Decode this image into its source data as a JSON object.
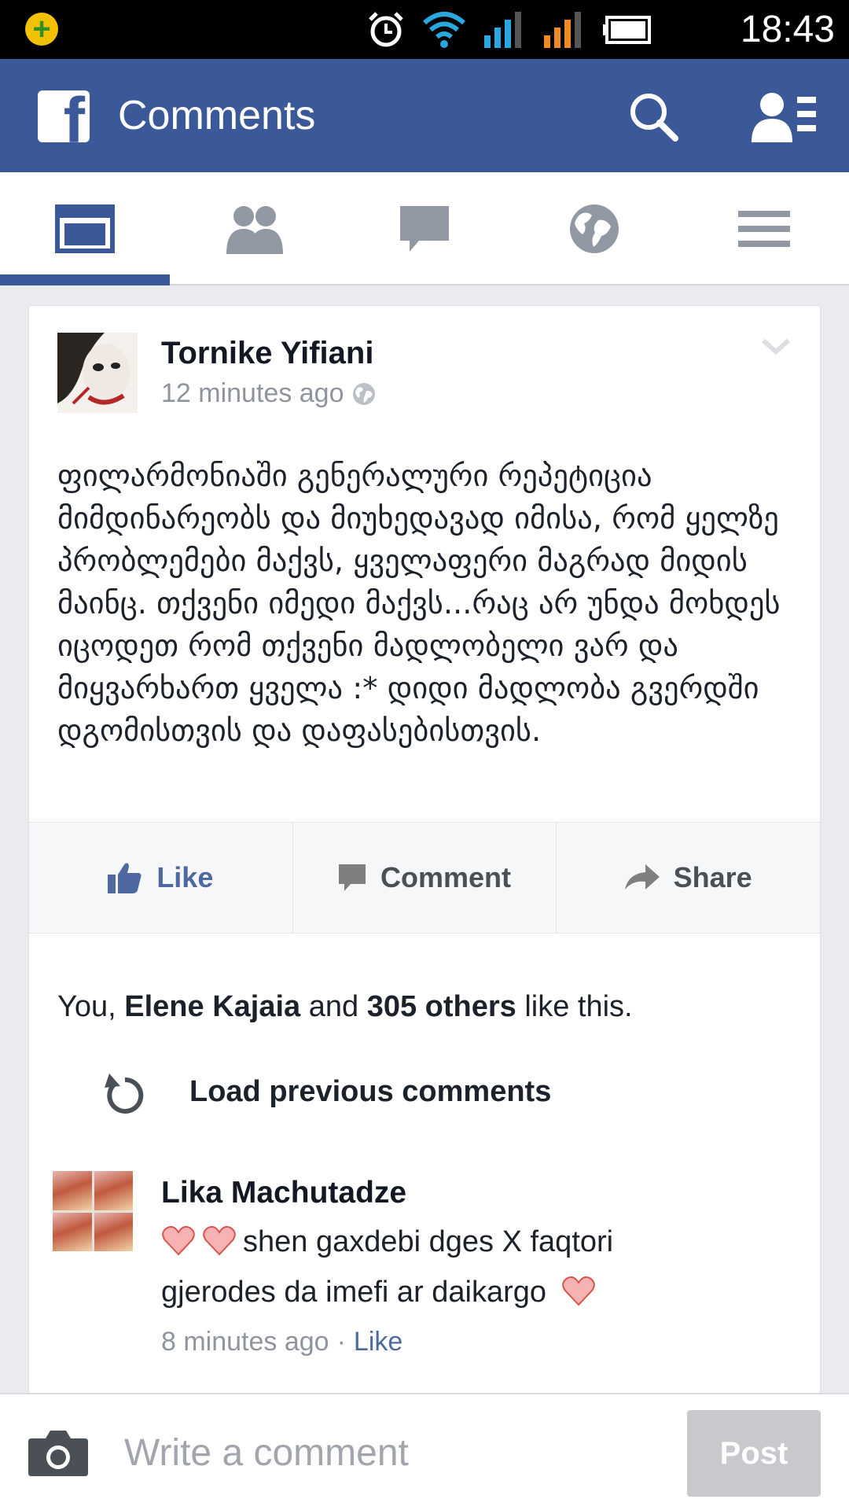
{
  "status_bar": {
    "time": "18:43",
    "icons": [
      "app-notification-icon",
      "alarm-icon",
      "wifi-icon",
      "signal-icon",
      "signal-icon",
      "battery-icon"
    ]
  },
  "app_bar": {
    "title": "Comments",
    "icons": [
      "facebook-logo-icon",
      "search-icon",
      "friend-requests-icon"
    ]
  },
  "tabs": [
    {
      "icon": "news-feed-icon",
      "selected": true
    },
    {
      "icon": "friends-icon",
      "selected": false
    },
    {
      "icon": "messages-icon",
      "selected": false
    },
    {
      "icon": "globe-icon",
      "selected": false
    },
    {
      "icon": "menu-icon",
      "selected": false
    }
  ],
  "post": {
    "author": "Tornike Yifiani",
    "time": "12 minutes ago",
    "text": "ფილარმონიაში გენერალური რეპეტიცია მიმდინარეობს და მიუხედავად იმისა, რომ ყელზე პრობლემები მაქვს, ყველაფერი მაგრად მიდის მაინც. თქვენი იმედი მაქვს...რაც არ უნდა მოხდეს იცოდეთ რომ თქვენი მადლობელი ვარ და მიყვარხართ ყველა :* დიდი მადლობა გვერდში დგომისთვის და დაფასებისთვის.",
    "actions": {
      "like": "Like",
      "comment": "Comment",
      "share": "Share"
    }
  },
  "likes": {
    "you": "You, ",
    "name": "Elene Kajaia",
    "and": " and ",
    "others": "305 others",
    "suffix": " like this."
  },
  "load_previous": "Load previous comments",
  "comments": [
    {
      "author": "Lika Machutadze",
      "text_part1": "shen gaxdebi dges X faqtori",
      "text_part2": "gjerodes da imefi ar daikargo",
      "time": "8 minutes ago",
      "separator": "·",
      "like": "Like"
    }
  ],
  "compose": {
    "placeholder": "Write a comment",
    "post_label": "Post"
  },
  "colors": {
    "brand": "#3b5998",
    "link": "#4e69a2",
    "muted": "#90949c",
    "heart": "#f7b3b3"
  }
}
